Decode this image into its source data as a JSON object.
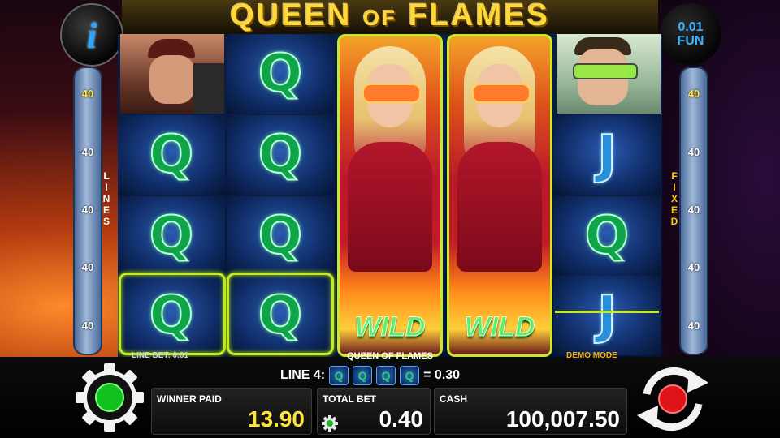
{
  "game": {
    "title_left": "QUEEN",
    "title_of": "OF",
    "title_right": "FLAMES",
    "name_strip": "QUEEN OF FLAMES"
  },
  "info_button": {
    "glyph": "i"
  },
  "fun": {
    "amount": "0.01",
    "label": "FUN"
  },
  "lines_left": {
    "label": "LINES",
    "values": [
      "40",
      "40",
      "40",
      "40",
      "40"
    ],
    "active_index": 0
  },
  "lines_right": {
    "label": "FIXED",
    "values": [
      "40",
      "40",
      "40",
      "40",
      "40"
    ],
    "active_index": 0
  },
  "reels": {
    "wild_label": "WILD",
    "reel1": [
      "portrait-villain",
      "Q",
      "Q",
      "Q"
    ],
    "reel2": [
      "Q",
      "Q",
      "Q",
      "Q"
    ],
    "reel3": [
      "WILD"
    ],
    "reel4": [
      "WILD"
    ],
    "reel5": [
      "portrait-scientist",
      "J",
      "Q",
      "J"
    ]
  },
  "line_bet": "LINE BET: 0.01",
  "demo_mode": "DEMO MODE",
  "win_line": {
    "label": "LINE 4:",
    "symbols": [
      "Q",
      "Q",
      "Q",
      "Q"
    ],
    "result": "= 0.30"
  },
  "winner_paid": {
    "label": "WINNER PAID",
    "value": "13.90"
  },
  "total_bet": {
    "label": "TOTAL BET",
    "value": "0.40"
  },
  "cash": {
    "label": "CASH",
    "value": "100,007.50"
  },
  "colors": {
    "accent": "#c6e92a",
    "gold": "#ffe23a",
    "blue": "#2ea4ff",
    "spin_red": "#e0121a",
    "settings_green": "#12c020"
  },
  "icons": [
    "info-icon",
    "settings-gear-icon",
    "spin-arrows-icon",
    "small-gear-icon"
  ]
}
